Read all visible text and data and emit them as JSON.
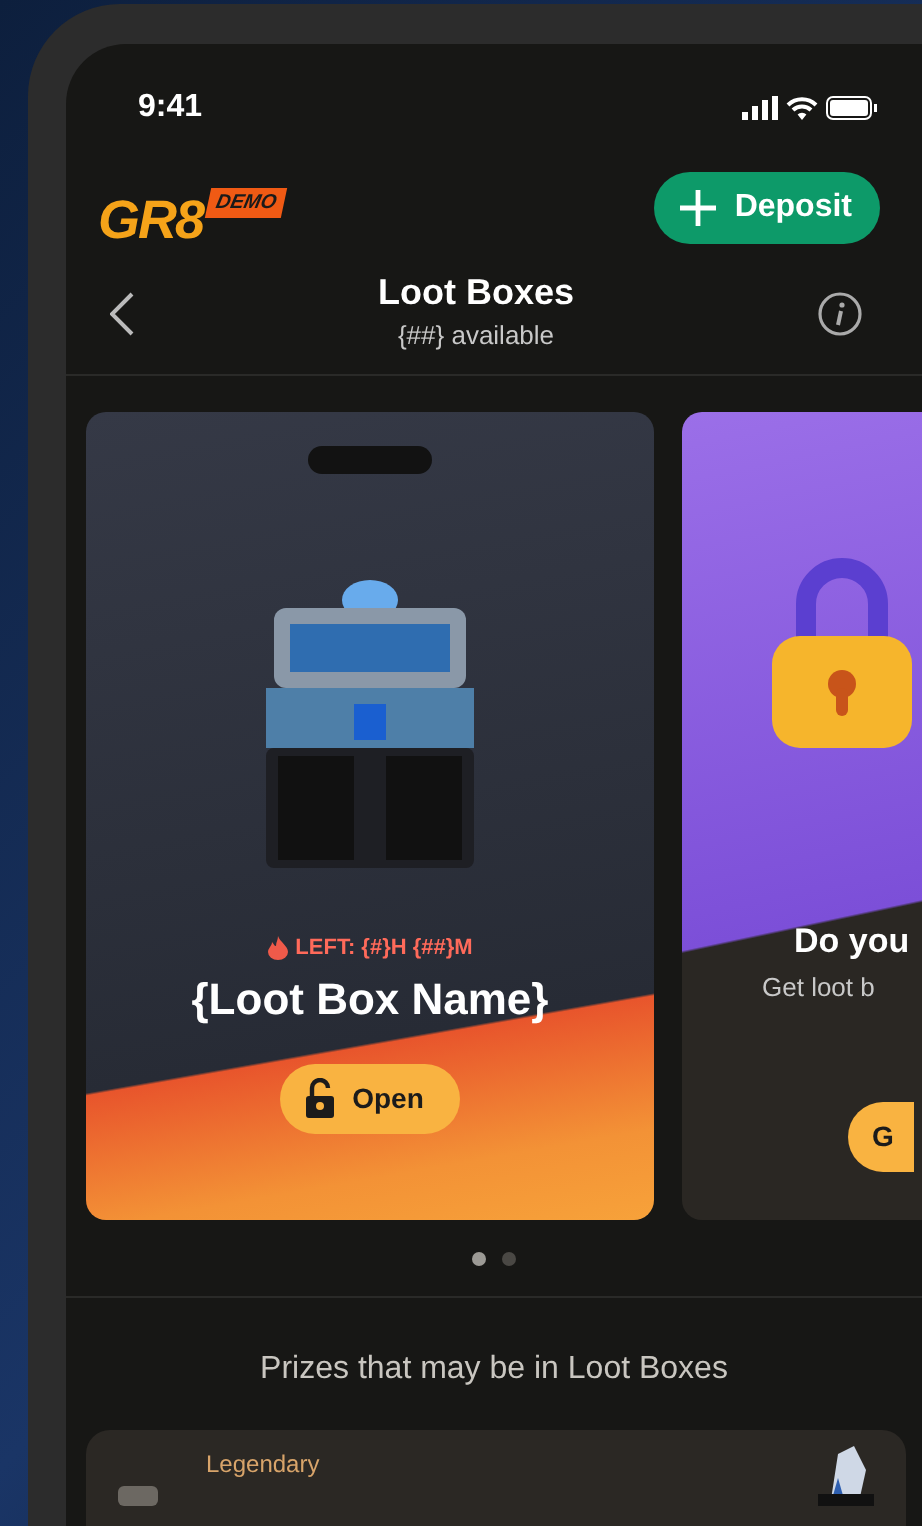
{
  "status_bar": {
    "time": "9:41"
  },
  "header": {
    "logo": "GR8",
    "logo_badge": "DEMO",
    "deposit_button": "Deposit"
  },
  "nav": {
    "title": "Loot Boxes",
    "subtitle": "{##} available"
  },
  "cards": [
    {
      "kind": "lootbox",
      "timer": "LEFT: {#}H {##}M",
      "name": "{Loot Box Name}",
      "button": "Open"
    },
    {
      "kind": "promo",
      "title": "Do you",
      "text": "Get loot b",
      "button": "G"
    }
  ],
  "page_dots": [
    {
      "selected": true
    },
    {
      "selected": false
    }
  ],
  "prizes_title": "Prizes that may be in Loot Boxes",
  "prizes": [
    {
      "tier": "Legendary"
    }
  ]
}
